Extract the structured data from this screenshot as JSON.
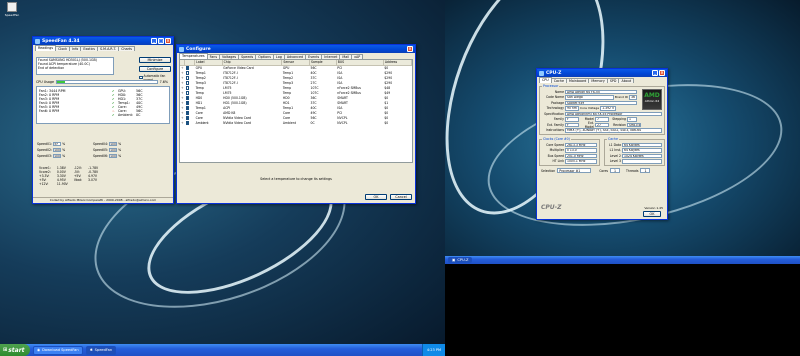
{
  "desktop_icon": {
    "label": "SpeedFan"
  },
  "taskbar_left": {
    "start": "start",
    "tasks": [
      "Download SpeedFan",
      "SpeedFan"
    ],
    "clock": "4:23 PM"
  },
  "taskbar_right": {
    "tasks": [
      "CPU-Z"
    ]
  },
  "speedfan": {
    "title": "SpeedFan 4.34",
    "tabs": [
      "Readings",
      "Clock",
      "Info",
      "Exotics",
      "S.M.A.R.T.",
      "Charts"
    ],
    "log": [
      "Found SAMSUNG HD501LJ (500.1GB)",
      "Found ACPI temperature (40.0C)",
      "End of detection"
    ],
    "minimize": "Minimize",
    "configure": "Configure",
    "automatic_fan_speed": "Automatic fan speed",
    "cpu_usage_label": "CPU Usage",
    "cpu_usage_value": "7.6%",
    "cpu_usage_fraction": 0.076,
    "fans": [
      "Fan1: 3444 RPM",
      "Fan2: 0 RPM",
      "Fan3: 0 RPM",
      "Fan4: 0 RPM",
      "Fan5: 0 RPM",
      "Fan6: 0 RPM"
    ],
    "temps": [
      {
        "status": "✔",
        "name": "GPU:",
        "value": "56C"
      },
      {
        "status": "✔",
        "name": "HD0:",
        "value": "36C"
      },
      {
        "status": "✔",
        "name": "HD1:",
        "value": "37C"
      },
      {
        "status": "✔",
        "name": "Temp1:",
        "value": "40C"
      },
      {
        "status": "✔",
        "name": "Core:",
        "value": "49C"
      },
      {
        "status": "♨",
        "name": "Core:",
        "value": "56C"
      },
      {
        "status": "✔",
        "name": "Ambient:",
        "value": "0C"
      }
    ],
    "speeds_left": [
      {
        "label": "Speed01:",
        "value": "37"
      },
      {
        "label": "Speed02:",
        "value": "100"
      },
      {
        "label": "Speed03:",
        "value": "100"
      }
    ],
    "speeds_right": [
      {
        "label": "Speed04:",
        "value": "100"
      },
      {
        "label": "Speed05:",
        "value": "100"
      },
      {
        "label": "Speed06:",
        "value": "100"
      }
    ],
    "pct": "%",
    "volts_col1": [
      "Vcore1:",
      "Vcore2:",
      "+3.3V:",
      "+5V:",
      "+12V:"
    ],
    "volts_col2": [
      "1.38V",
      "0.00V",
      "3.30V",
      "4.95V",
      "11.90V"
    ],
    "volts_col3": [
      "-12V:",
      "-5V:",
      "+5V:",
      "Vbat:"
    ],
    "volts_col4": [
      "-1.78V",
      "-0.78V",
      "4.97V",
      "3.07V"
    ],
    "status": "Coded by Alfredo Milani Comparetti - 2000-2008 - alfredo@almico.com"
  },
  "configure": {
    "title": "Configure",
    "tabs": [
      "Temperatures",
      "Fans",
      "Voltages",
      "Speeds",
      "Options",
      "Log",
      "Advanced",
      "Events",
      "Internet",
      "Mail",
      "xAP"
    ],
    "columns": [
      "Label",
      "Chip",
      "Sensor",
      "Sample",
      "BUS",
      "Address"
    ],
    "rows": [
      {
        "checked": true,
        "label": "GPU",
        "chip": "GeForce Video Card",
        "sensor": "GPU",
        "sample": "56C",
        "bus": "PCI",
        "address": "$0"
      },
      {
        "checked": false,
        "label": "Temp1",
        "chip": "IT8712F-I",
        "sensor": "Temp1",
        "sample": "40C",
        "bus": "ISA",
        "address": "$290"
      },
      {
        "checked": false,
        "label": "Temp2",
        "chip": "IT8712F-I",
        "sensor": "Temp2",
        "sample": "37C",
        "bus": "ISA",
        "address": "$290"
      },
      {
        "checked": false,
        "label": "Temp3",
        "chip": "IT8712F-I",
        "sensor": "Temp3",
        "sample": "27C",
        "bus": "ISA",
        "address": "$290"
      },
      {
        "checked": false,
        "label": "Temp",
        "chip": "LM75",
        "sensor": "Temp",
        "sample": "107C",
        "bus": "nForce2 SMBus",
        "address": "$48"
      },
      {
        "checked": false,
        "label": "Temp",
        "chip": "LM75",
        "sensor": "Temp",
        "sample": "107C",
        "bus": "nForce2 SMBus",
        "address": "$49"
      },
      {
        "checked": true,
        "label": "HD0",
        "chip": "HD0 (500.1GB)",
        "sensor": "HD0",
        "sample": "36C",
        "bus": "SMART",
        "address": "$0"
      },
      {
        "checked": true,
        "label": "HD1",
        "chip": "HD1 (500.1GB)",
        "sensor": "HD1",
        "sample": "37C",
        "bus": "SMART",
        "address": "$1"
      },
      {
        "checked": true,
        "label": "Temp1",
        "chip": "ACPI",
        "sensor": "Temp1",
        "sample": "40C",
        "bus": "ISA",
        "address": "$0"
      },
      {
        "checked": true,
        "label": "Core",
        "chip": "AMD K8",
        "sensor": "Core",
        "sample": "49C",
        "bus": "PCI",
        "address": "$0"
      },
      {
        "checked": true,
        "label": "Core",
        "chip": "NVidia Video Card",
        "sensor": "Core",
        "sample": "56C",
        "bus": "NVCPL",
        "address": "$0"
      },
      {
        "checked": true,
        "label": "Ambient",
        "chip": "NVidia Video Card",
        "sensor": "Ambient",
        "sample": "0C",
        "bus": "NVCPL",
        "address": "$0"
      }
    ],
    "hint": "Select a temperature to change its settings",
    "ok": "OK",
    "cancel": "Cancel"
  },
  "cpuz": {
    "title": "CPU-Z",
    "tabs": [
      "CPU",
      "Cache",
      "Mainboard",
      "Memory",
      "SPD",
      "About"
    ],
    "processor_legend": "Processor",
    "name": "AMD Athlon 64 FX-55",
    "code_name": "San Diego",
    "brand_id_label": "Brand ID",
    "brand_id": "36",
    "package": "Socket 939",
    "technology": "90 nm",
    "core_voltage_label": "Core Voltage",
    "core_voltage": "1.392 V",
    "specification": "AMD Athlon(tm) 64 FX-55 Processor",
    "family": "F",
    "model_label": "Model",
    "model": "7",
    "stepping_label": "Stepping",
    "stepping": "1",
    "ext_family": "F",
    "ext_model_label": "Ext. Model",
    "ext_model": "27",
    "revision_label": "Revision",
    "revision": "SH8-E4",
    "instructions": "MMX (+), 3DNow! (+), SSE, SSE2, SSE3, x86-64",
    "clocks_legend": "Clocks (Core #0)",
    "core_speed": "2613.3 MHz",
    "multiplier": "x 13.0",
    "bus_speed": "201.0 MHz",
    "ht_link": "1005.1 MHz",
    "cache_legend": "Cache",
    "l1_data": "64 KBytes",
    "l1_inst": "64 KBytes",
    "level2": "1024 KBytes",
    "level3": "",
    "selection_label": "Selection",
    "selection": "Processor #1",
    "cores_label": "Cores",
    "cores": "1",
    "threads_label": "Threads",
    "threads": "1",
    "version": "Version 1.45",
    "logo": "CPU-Z",
    "ok": "OK",
    "labels": {
      "name": "Name",
      "code_name": "Code Name",
      "package": "Package",
      "technology": "Technology",
      "specification": "Specification",
      "family": "Family",
      "ext_family": "Ext. Family",
      "instructions": "Instructions",
      "core_speed": "Core Speed",
      "multiplier": "Multiplier",
      "bus_speed": "Bus Speed",
      "ht_link": "HT Link",
      "l1_data": "L1 Data",
      "l1_inst": "L1 Inst.",
      "level2": "Level 2",
      "level3": "Level 3"
    },
    "amd_badge_top": "AMD",
    "amd_badge_bottom": "Athlon 64"
  }
}
